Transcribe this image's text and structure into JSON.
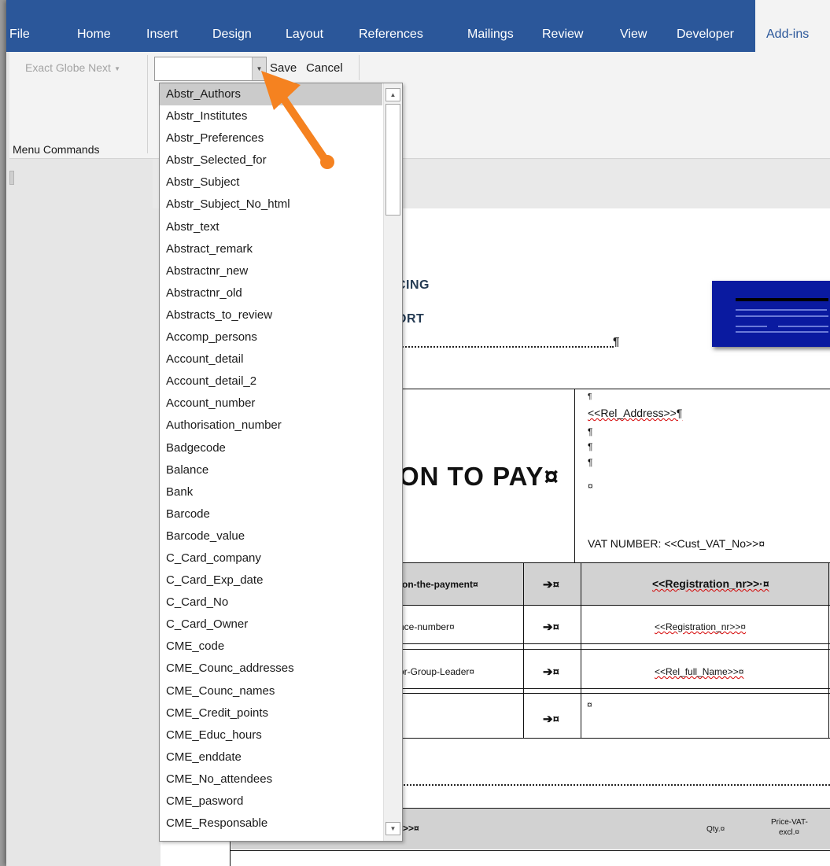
{
  "ribbon_tabs": [
    "File",
    "Home",
    "Insert",
    "Design",
    "Layout",
    "References",
    "Mailings",
    "Review",
    "View",
    "Developer",
    "Add-ins"
  ],
  "ribbon": {
    "exact_globe_next": "Exact Globe Next",
    "combo_value": "",
    "save_label": "Save",
    "cancel_label": "Cancel",
    "group_label": "Menu Commands"
  },
  "dropdown": {
    "selected": "Abstr_Authors",
    "items": [
      "Abstr_Authors",
      "Abstr_Institutes",
      "Abstr_Preferences",
      "Abstr_Selected_for",
      "Abstr_Subject",
      "Abstr_Subject_No_html",
      "Abstr_text",
      "Abstract_remark",
      "Abstractnr_new",
      "Abstractnr_old",
      "Abstracts_to_review",
      "Accomp_persons",
      "Account_detail",
      "Account_detail_2",
      "Account_number",
      "Authorisation_number",
      "Badgecode",
      "Balance",
      "Bank",
      "Barcode",
      "Barcode_value",
      "C_Card_company",
      "C_Card_Exp_date",
      "C_Card_No",
      "C_Card_Owner",
      "CME_code",
      "CME_Counc_addresses",
      "CME_Counc_names",
      "CME_Credit_points",
      "CME_Educ_hours",
      "CME_enddate",
      "CME_No_attendees",
      "CME_pasword",
      "CME_Responsable"
    ]
  },
  "document": {
    "heading_1": "CING",
    "heading_2": "ORT",
    "pilcrow": "¶",
    "big_title": "ON TO PAY¤",
    "address_field": "<<Rel_Address>>¶",
    "pilcrows": [
      "¶",
      "¶",
      "¶",
      "¶"
    ],
    "currency_mark": "¤",
    "vat_line": "VAT NUMBER: <<Cust_VAT_No>>¤",
    "rows": [
      {
        "label": "-on-the-payment¤",
        "arrow": "➔¤",
        "value": "<<Registration_nr>>·¤"
      },
      {
        "label": "nce-number¤",
        "arrow": "➔¤",
        "value": "<<Registration_nr>>¤"
      },
      {
        "label": "or-Group-Leader¤",
        "arrow": "➔¤",
        "value": "<<Rel_full_Name>>¤"
      },
      {
        "label": "",
        "arrow": "➔¤",
        "value": "¤"
      }
    ],
    "bottom_field": ">>¤",
    "qty_label": "Qty.¤",
    "price_label_1": "Price-VAT-",
    "price_label_2": "excl.¤"
  },
  "colors": {
    "ribbon_blue": "#2b579a",
    "callout_orange": "#f58220",
    "logo_box": "#0a1aa0"
  }
}
